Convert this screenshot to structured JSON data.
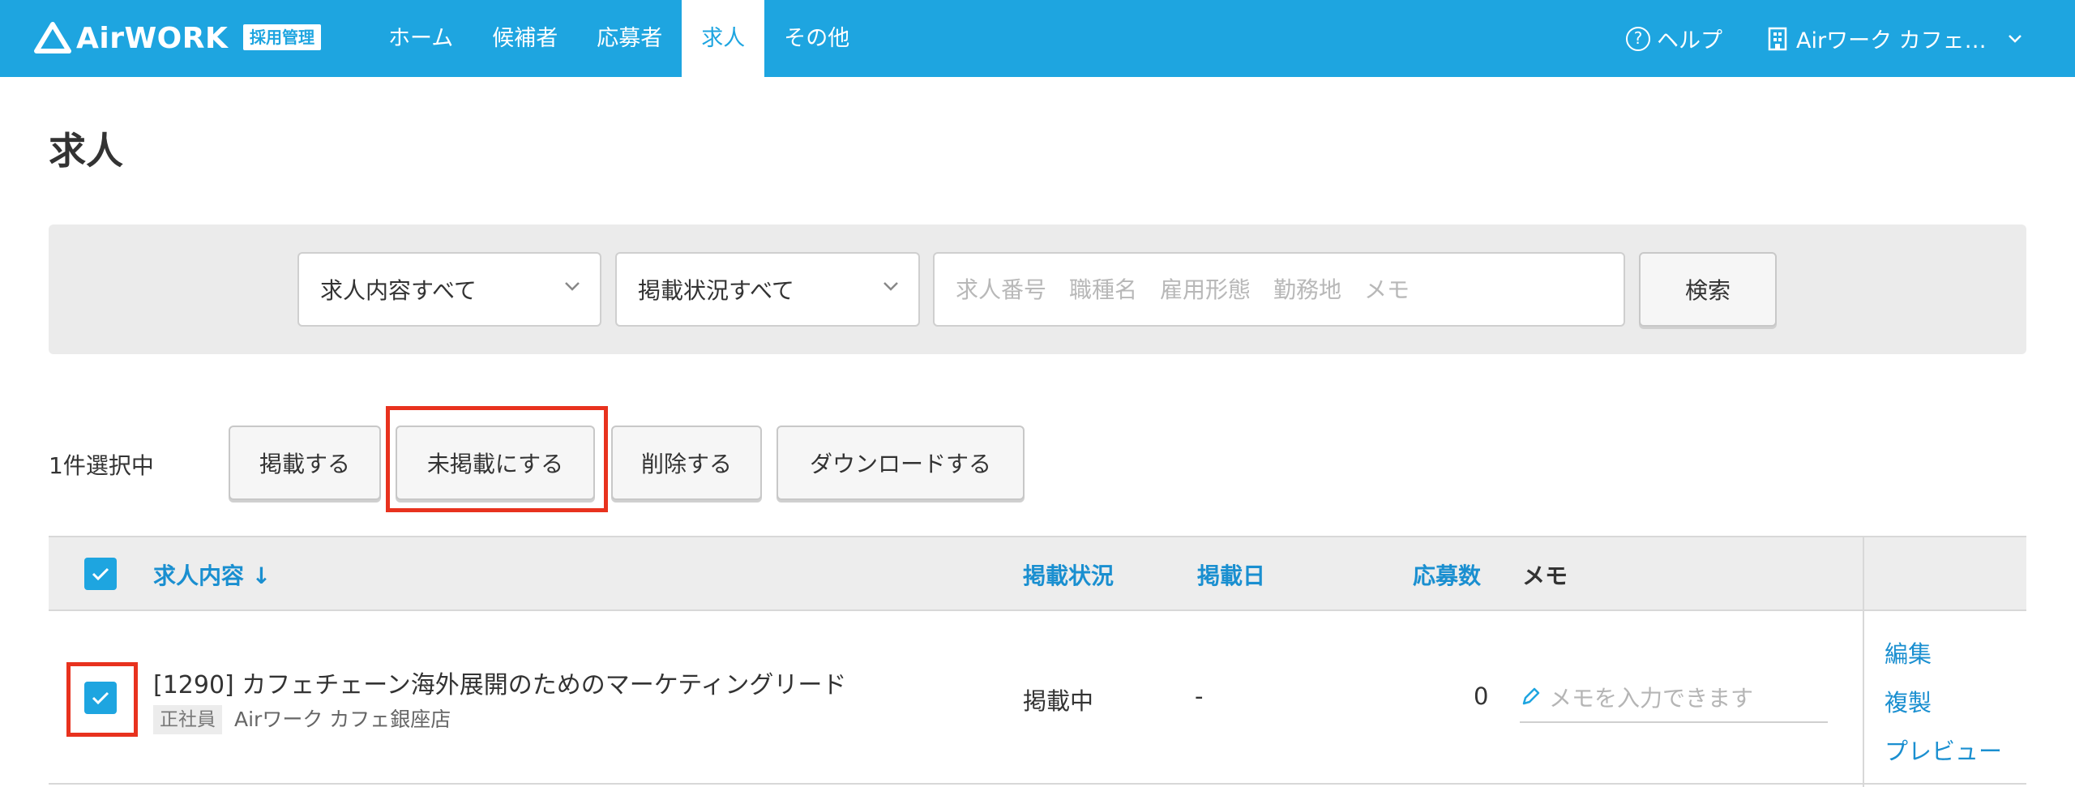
{
  "header": {
    "logo_text": "AirWORK",
    "logo_badge": "採用管理",
    "nav": [
      "ホーム",
      "候補者",
      "応募者",
      "求人",
      "その他"
    ],
    "active_nav": "求人",
    "help_label": "ヘルプ",
    "store_label": "Airワーク カフェ…",
    "brand_color": "#1ea5e0"
  },
  "page_title": "求人",
  "search": {
    "content_select": "求人内容すべて",
    "status_select": "掲載状況すべて",
    "placeholder": "求人番号　職種名　雇用形態　勤務地　メモ",
    "button": "検索"
  },
  "bulk": {
    "selected_count": "1件選択中",
    "publish": "掲載する",
    "unpublish": "未掲載にする",
    "delete": "削除する",
    "download": "ダウンロードする"
  },
  "table": {
    "headers": {
      "content": "求人内容 ↓",
      "status": "掲載状況",
      "date": "掲載日",
      "applicants": "応募数",
      "memo": "メモ"
    },
    "rows": [
      {
        "title": "[1290] カフェチェーン海外展開のためのマーケティングリード",
        "employment_type": "正社員",
        "store": "Airワーク カフェ銀座店",
        "status": "掲載中",
        "date": "-",
        "applicants": "0",
        "memo_placeholder": "メモを入力できます",
        "actions": [
          "編集",
          "複製",
          "プレビュー"
        ],
        "checked": true
      }
    ]
  },
  "highlight_color": "#e8321e"
}
